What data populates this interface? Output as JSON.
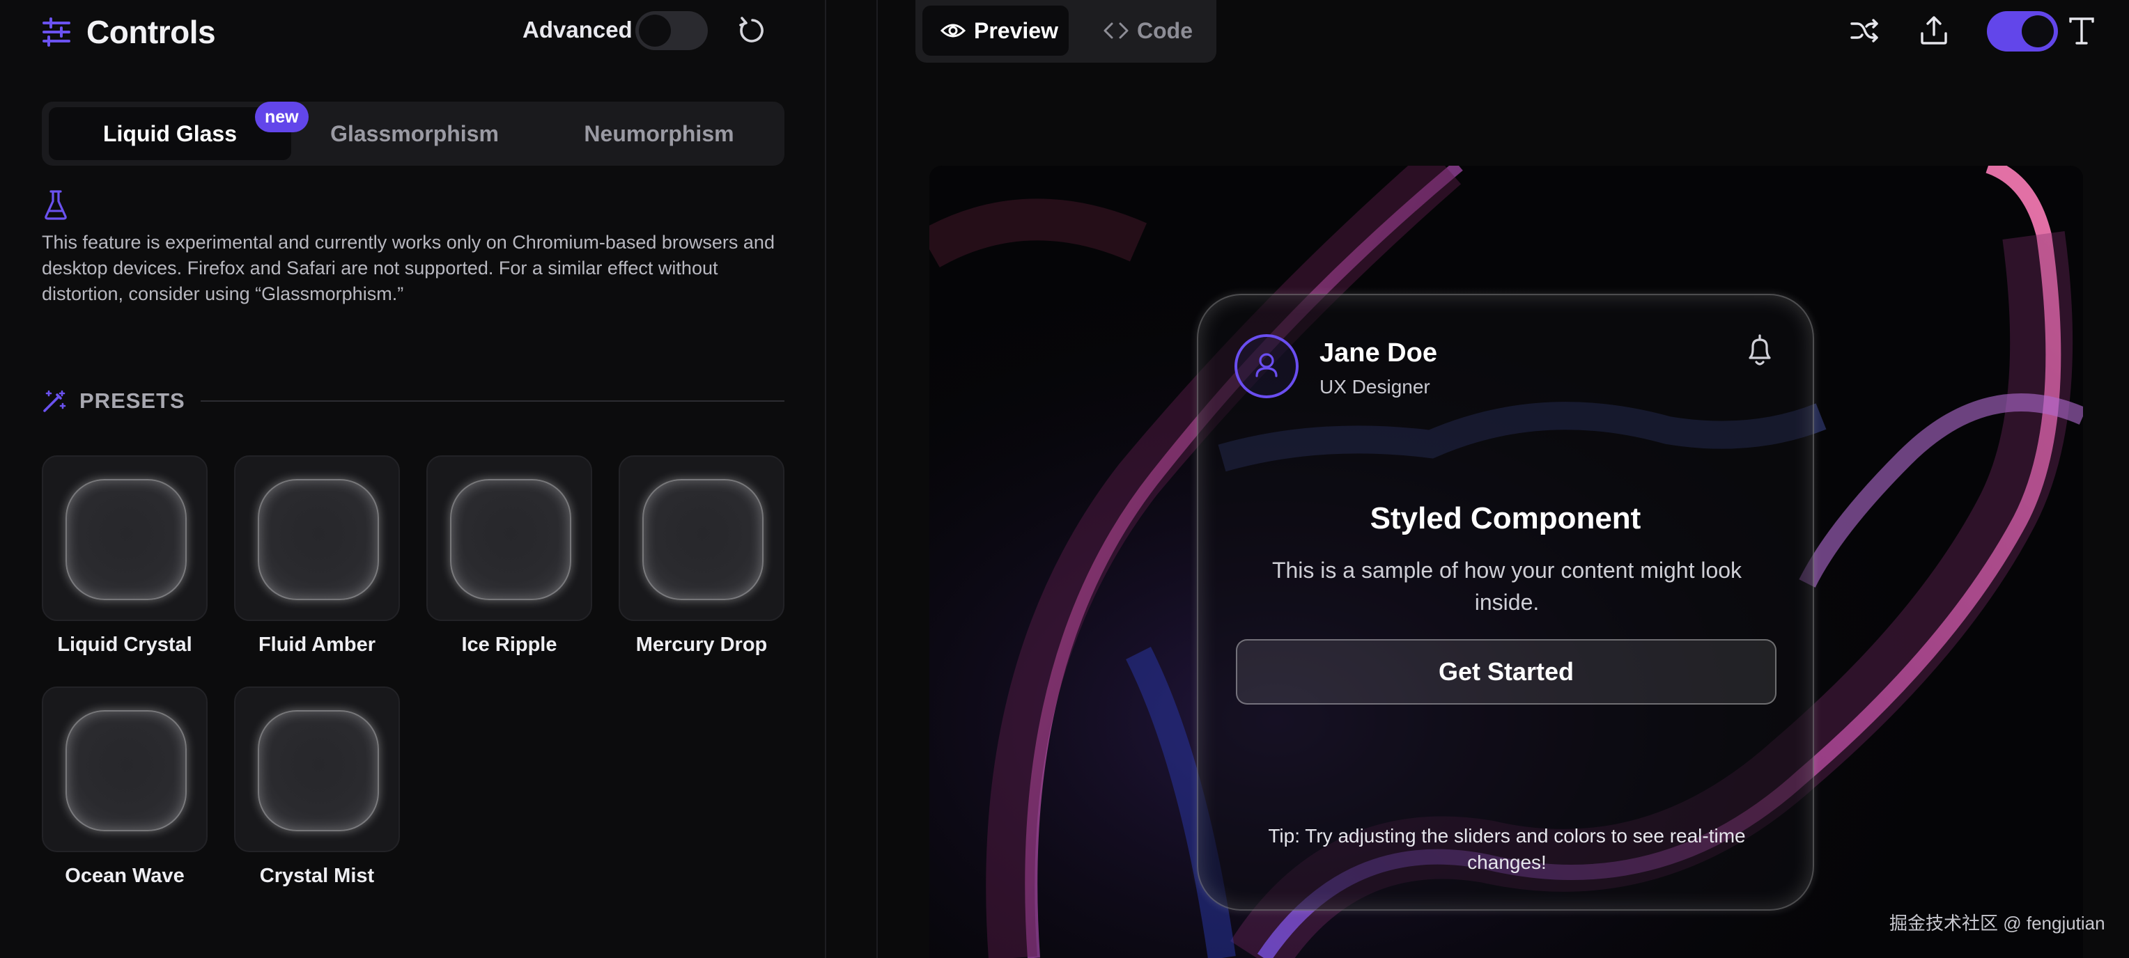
{
  "controls": {
    "title": "Controls",
    "advanced_label": "Advanced",
    "advanced_on": false
  },
  "tabs": [
    {
      "label": "Liquid Glass",
      "active": true,
      "badge": "new"
    },
    {
      "label": "Glassmorphism",
      "active": false
    },
    {
      "label": "Neumorphism",
      "active": false
    }
  ],
  "note": "This feature is experimental and currently works only on Chromium-based browsers and desktop devices. Firefox and Safari are not supported. For a similar effect without distortion, consider using “Glassmorphism.”",
  "presets": {
    "heading": "PRESETS",
    "items": [
      {
        "name": "Liquid Crystal"
      },
      {
        "name": "Fluid Amber"
      },
      {
        "name": "Ice Ripple"
      },
      {
        "name": "Mercury Drop"
      },
      {
        "name": "Ocean Wave"
      },
      {
        "name": "Crystal Mist"
      }
    ]
  },
  "view": {
    "preview_label": "Preview",
    "code_label": "Code",
    "active": "Preview"
  },
  "toolbar": {
    "theme_toggle_on": true,
    "accent_color": "#6246ea"
  },
  "card": {
    "name": "Jane Doe",
    "role": "UX Designer",
    "title": "Styled Component",
    "text": "This is a sample of how your content might look inside.",
    "button": "Get Started",
    "tip": "Tip: Try adjusting the sliders and colors to see real-time changes!"
  },
  "watermark": "掘金技术社区 @ fengjutian"
}
